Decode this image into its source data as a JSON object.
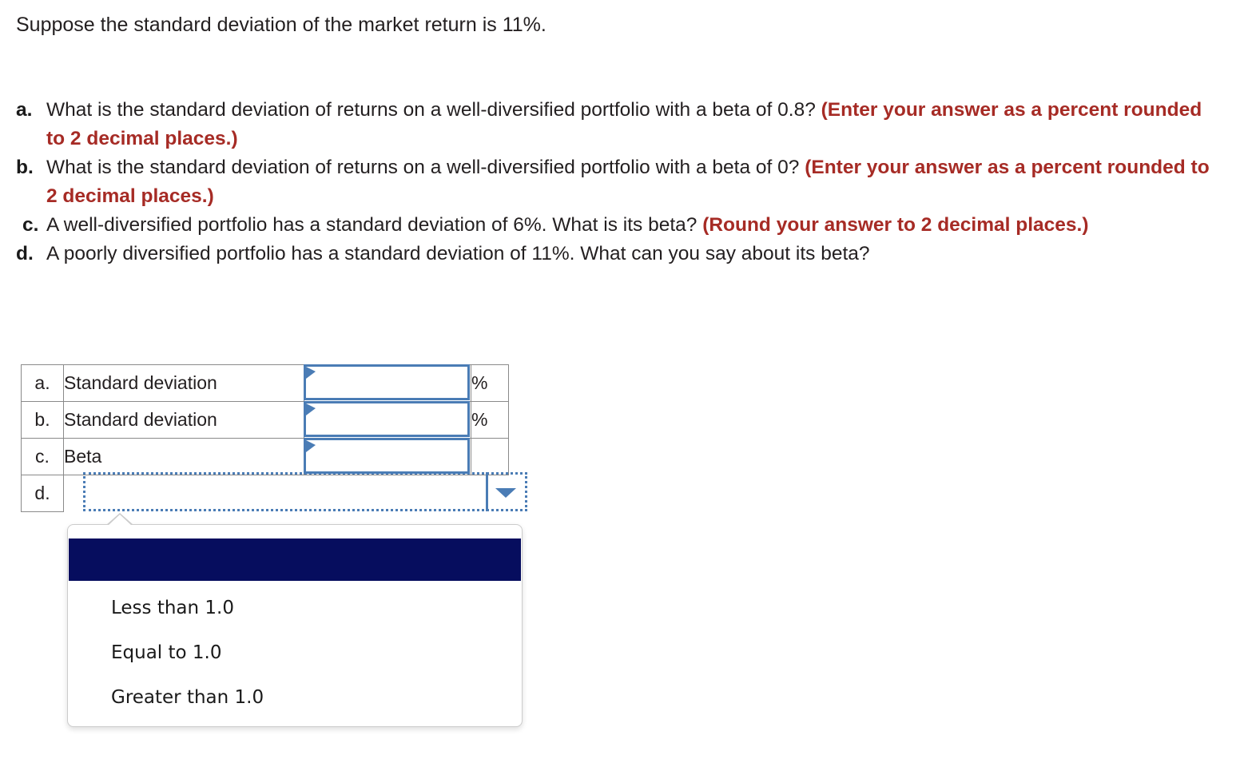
{
  "intro": "Suppose the standard deviation of the market return is 11%.",
  "questions": [
    {
      "marker": "a.",
      "text": "What is the standard deviation of returns on a well-diversified portfolio with a beta of 0.8? ",
      "emphasis": "(Enter your answer as a percent rounded to 2 decimal places.)"
    },
    {
      "marker": "b.",
      "text": "What is the standard deviation of returns on a well-diversified portfolio with a beta of 0? ",
      "emphasis": "(Enter your answer as a percent rounded to 2 decimal places.)"
    },
    {
      "marker": "c.",
      "text": "A well-diversified portfolio has a standard deviation of 6%. What is its beta? ",
      "emphasis": "(Round your answer to 2 decimal places.)"
    },
    {
      "marker": "d.",
      "text": "A poorly diversified portfolio has a standard deviation of 11%. What can you say about its beta?",
      "emphasis": ""
    }
  ],
  "answer_table": {
    "rows": [
      {
        "letter": "a.",
        "label": "Standard deviation",
        "value": "",
        "unit": "%"
      },
      {
        "letter": "b.",
        "label": "Standard deviation",
        "value": "",
        "unit": "%"
      },
      {
        "letter": "c.",
        "label": "Beta",
        "value": "",
        "unit": ""
      },
      {
        "letter": "d.",
        "label": "",
        "value": "",
        "unit": ""
      }
    ]
  },
  "dropdown": {
    "selected_option": "",
    "options": [
      "Less than 1.0",
      "Equal to 1.0",
      "Greater than 1.0"
    ]
  },
  "colors": {
    "emphasis_red": "#a62b25",
    "input_border_blue": "#4a7cb5",
    "selected_option_navy": "#060d5e",
    "table_border_gray": "#8a8a8a"
  }
}
